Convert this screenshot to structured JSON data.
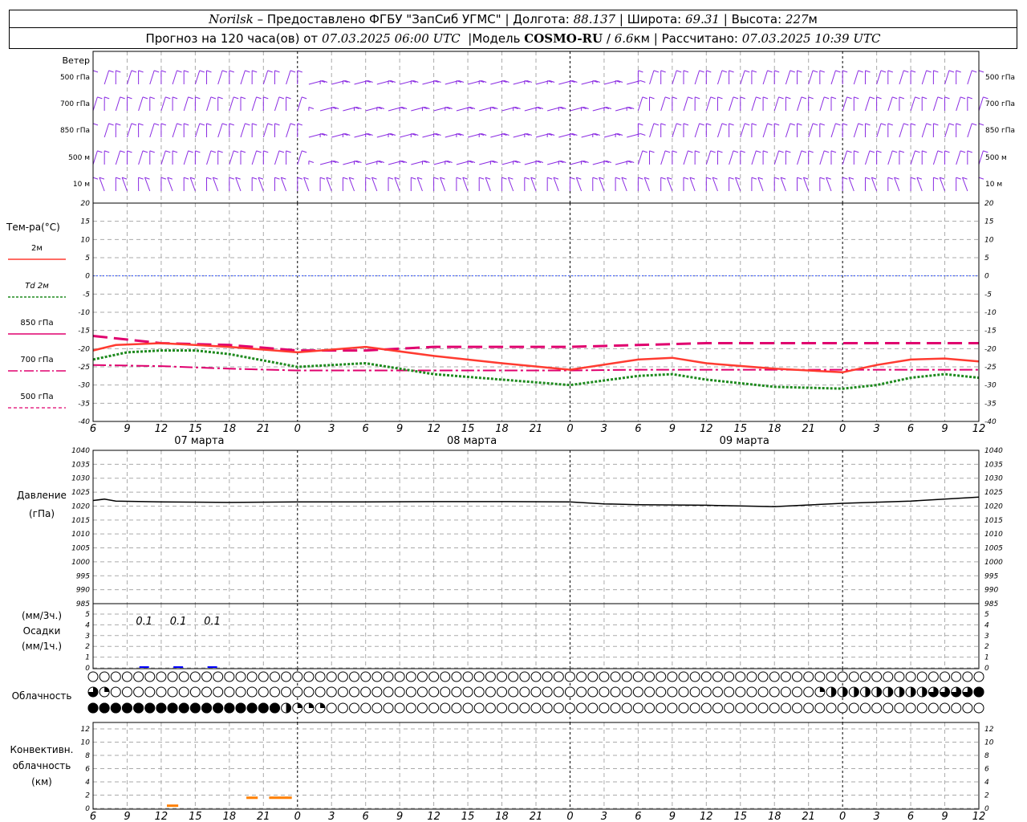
{
  "header": {
    "station": "Norilsk",
    "provider": "– Предоставлено ФГБУ \"ЗапСиб УГМС\"",
    "lon_label": "Долгота:",
    "lon": "88.137",
    "lat_label": "Широта:",
    "lat": "69.31",
    "alt_label": "Высота:",
    "alt": "227",
    "alt_unit": "м",
    "forecast_label": "Прогноз на 120 часа(ов) от",
    "forecast_start": "07.03.2025 06:00 UTC",
    "model_label": "Модель",
    "model": "COSMO-RU",
    "resolution": "6.6",
    "res_unit": "км",
    "calc_label": "Рассчитано:",
    "calc_time": "07.03.2025 10:39 UTC",
    "sep": "|",
    "slash": "/"
  },
  "labels": {
    "wind": "Ветер",
    "wind_levels": [
      "500 гПа",
      "700 гПа",
      "850 гПа",
      "500 м",
      "10 м"
    ],
    "temp_title": "Тем-ра(°C)",
    "legend": [
      "2м",
      "Td 2м",
      "850 гПа",
      "700 гПа",
      "500 гПа"
    ],
    "pressure_title": "Давление",
    "pressure_unit": "(гПа)",
    "precip_unit_top": "(мм/3ч.)",
    "precip_title": "Осадки",
    "precip_unit_bottom": "(мм/1ч.)",
    "cloud_title": "Облачность",
    "conv_title": [
      "Конвективн.",
      "облачность",
      "(км)"
    ],
    "day_labels": [
      "07 марта",
      "08 марта",
      "09 марта"
    ]
  },
  "colors": {
    "t2m": "#ff3b30",
    "td2m": "#1e8a1e",
    "t850": "#e0006e",
    "t700": "#e0006e",
    "t500": "#e0006e",
    "zero_line": "#3355ff",
    "wind": "#8a2be2",
    "pressure": "#000000",
    "precip": "#0000ff",
    "conv": "#ff7f00"
  },
  "chart_data": [
    {
      "type": "line",
      "name": "temperature",
      "x_ticks": [
        "6",
        "9",
        "12",
        "15",
        "18",
        "21",
        "0",
        "3",
        "6",
        "9",
        "12",
        "15",
        "18",
        "21",
        "0",
        "3",
        "6",
        "9",
        "12",
        "15",
        "18",
        "21",
        "0",
        "3",
        "6",
        "9",
        "12"
      ],
      "x_hours": [
        0,
        3,
        6,
        9,
        12,
        15,
        18,
        21,
        24,
        27,
        30,
        33,
        36,
        39,
        42,
        45,
        48,
        51,
        54,
        57,
        60,
        63,
        66,
        69,
        72,
        75,
        78
      ],
      "ylim": [
        -40,
        20
      ],
      "y_ticks": [
        20,
        15,
        10,
        5,
        0,
        -5,
        -10,
        -15,
        -20,
        -25,
        -30,
        -35,
        -40
      ],
      "series": [
        {
          "name": "2м",
          "x": [
            0,
            2,
            6,
            12,
            18,
            24,
            30,
            36,
            42,
            48,
            51,
            54,
            60,
            66,
            69,
            72,
            75,
            78
          ],
          "values": [
            -20.5,
            -19,
            -18.5,
            -19.5,
            -21,
            -19.5,
            -22,
            -24,
            -25.8,
            -23,
            -22.5,
            -24,
            -25.5,
            -26.5,
            -24.5,
            -23,
            -22.7,
            -23.5
          ]
        },
        {
          "name": "Td 2м",
          "x": [
            0,
            3,
            6,
            9,
            12,
            18,
            24,
            30,
            36,
            42,
            48,
            51,
            54,
            60,
            66,
            69,
            72,
            75,
            78
          ],
          "values": [
            -23,
            -21,
            -20.5,
            -20.5,
            -21.5,
            -25,
            -24,
            -27,
            -28.5,
            -30,
            -27.5,
            -27,
            -28.5,
            -30.5,
            -31,
            -30,
            -28,
            -27,
            -28
          ]
        },
        {
          "name": "850 гПа",
          "x": [
            0,
            6,
            12,
            18,
            24,
            30,
            36,
            42,
            48,
            54,
            60,
            66,
            72,
            78
          ],
          "values": [
            -16.5,
            -18.5,
            -19,
            -20.5,
            -20.5,
            -19.5,
            -19.5,
            -19.5,
            -19,
            -18.5,
            -18.5,
            -18.5,
            -18.5,
            -18.5
          ]
        },
        {
          "name": "700 гПа",
          "x": [
            0,
            6,
            12,
            18,
            24,
            30,
            36,
            42,
            48,
            54,
            60,
            66,
            72,
            78
          ],
          "values": [
            -24.5,
            -24.8,
            -25.5,
            -26,
            -26,
            -26,
            -26,
            -26,
            -25.8,
            -25.8,
            -25.8,
            -25.8,
            -25.8,
            -25.8
          ]
        }
      ]
    },
    {
      "type": "line",
      "name": "pressure",
      "ylim": [
        985,
        1040
      ],
      "y_ticks": [
        1040,
        1035,
        1030,
        1025,
        1020,
        1015,
        1010,
        1005,
        1000,
        995,
        990,
        985
      ],
      "series": [
        {
          "name": "pressure",
          "x": [
            0,
            1,
            2,
            6,
            12,
            18,
            24,
            30,
            36,
            42,
            45,
            48,
            54,
            60,
            66,
            72,
            78
          ],
          "values": [
            1022,
            1022.5,
            1021.8,
            1021.5,
            1021.3,
            1021.5,
            1021.5,
            1021.6,
            1021.6,
            1021.5,
            1020.8,
            1020.5,
            1020.3,
            1019.8,
            1021,
            1021.8,
            1023.2
          ]
        }
      ]
    },
    {
      "type": "bar",
      "name": "precipitation",
      "ylim": [
        0,
        5
      ],
      "y_ticks": [
        5,
        4,
        3,
        2,
        1,
        0
      ],
      "labels": [
        {
          "x": 4.5,
          "value": "0.1"
        },
        {
          "x": 7.5,
          "value": "0.1"
        },
        {
          "x": 10.5,
          "value": "0.1"
        }
      ]
    },
    {
      "type": "bar",
      "name": "convective_cloud",
      "ylim": [
        0,
        12
      ],
      "y_ticks": [
        12,
        10,
        8,
        6,
        4,
        2,
        0
      ],
      "segments": [
        {
          "x0": 6.5,
          "x1": 7.5,
          "y": 0.4
        },
        {
          "x0": 13.5,
          "x1": 14.5,
          "y": 1.6
        },
        {
          "x0": 15.5,
          "x1": 17.5,
          "y": 1.6
        }
      ]
    }
  ],
  "clouds": {
    "top_row_levels": [
      0,
      0,
      0,
      0,
      0,
      0,
      0,
      0,
      0,
      0,
      0,
      0,
      0,
      0,
      0,
      0,
      0,
      0,
      0,
      0,
      0,
      0,
      0,
      0,
      0,
      0,
      0,
      0,
      0,
      0,
      0,
      0,
      0,
      0,
      0,
      0,
      0,
      0,
      0,
      0,
      0,
      0,
      0,
      0,
      0,
      0,
      0,
      0,
      0,
      0,
      0,
      0,
      0,
      0,
      0,
      0,
      0,
      0,
      0,
      0,
      0,
      0,
      0,
      0,
      0,
      0,
      0,
      0,
      0,
      0,
      0,
      0,
      0,
      0,
      0,
      0,
      0,
      0,
      0
    ],
    "mid_row_levels": [
      0.75,
      0.25,
      0,
      0,
      0,
      0,
      0,
      0,
      0,
      0,
      0,
      0,
      0,
      0,
      0,
      0,
      0,
      0,
      0,
      0,
      0,
      0,
      0,
      0,
      0,
      0,
      0,
      0,
      0,
      0,
      0,
      0,
      0,
      0,
      0,
      0,
      0,
      0,
      0,
      0,
      0,
      0,
      0,
      0,
      0,
      0,
      0,
      0,
      0,
      0,
      0,
      0,
      0,
      0,
      0,
      0,
      0,
      0,
      0,
      0,
      0,
      0,
      0,
      0,
      0.25,
      0.5,
      0.5,
      0.5,
      0.5,
      0.5,
      0.5,
      0.5,
      0.5,
      0.5,
      0.75,
      0.75,
      0.75,
      0.75,
      1
    ],
    "low_row_levels": [
      1,
      1,
      1,
      1,
      1,
      1,
      1,
      1,
      1,
      1,
      1,
      1,
      1,
      1,
      1,
      1,
      1,
      0.5,
      0.25,
      0.25,
      0.25,
      0,
      0,
      0,
      0,
      0,
      0,
      0,
      0,
      0,
      0,
      0,
      0,
      0,
      0,
      0,
      0,
      0,
      0,
      0,
      0,
      0,
      0,
      0,
      0,
      0,
      0,
      0,
      0,
      0,
      0,
      0,
      0,
      0,
      0,
      0,
      0,
      0,
      0,
      0,
      0,
      0,
      0,
      0,
      0,
      0,
      0,
      0,
      0,
      0,
      0,
      0,
      0,
      0,
      0,
      0,
      0,
      0,
      0
    ]
  }
}
